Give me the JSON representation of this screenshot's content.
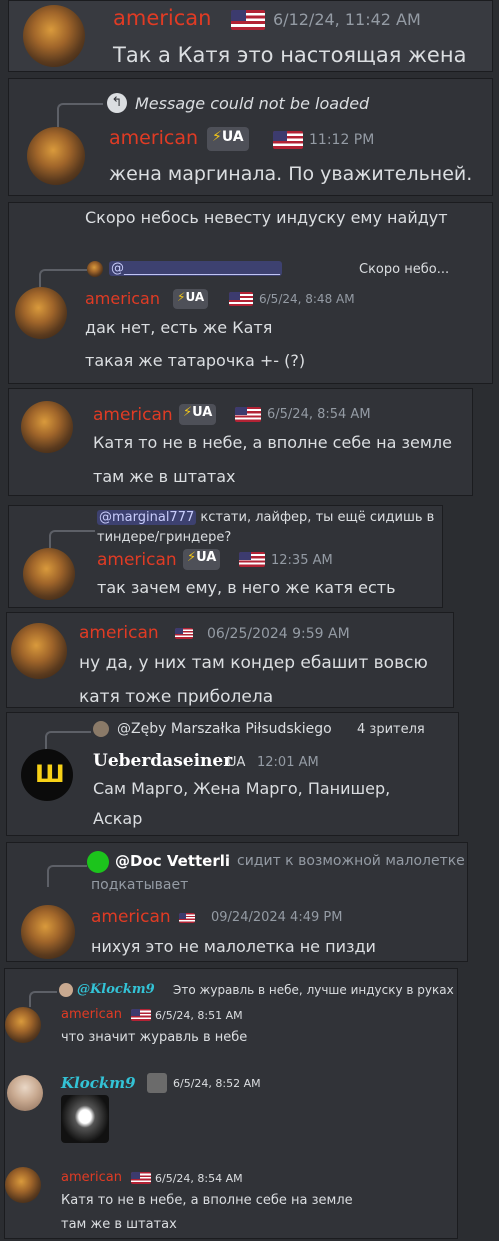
{
  "m1": {
    "author": "american",
    "time": "6/12/24, 11:42 AM",
    "text": "Так а Катя это настоящая жена"
  },
  "m2": {
    "reply_text": "Message could not be loaded",
    "author": "american",
    "badge": "UA",
    "time": "11:12 PM",
    "text": "жена маргинала. По уважительней."
  },
  "m3": {
    "prev_text": "Скоро небось невесту индуску ему найдут",
    "reply_mention": "@________________________",
    "reply_text": "Скоро небо...",
    "author": "american",
    "badge": "UA",
    "time": "6/5/24, 8:48 AM",
    "line1": "дак нет, есть же Катя",
    "line2": "такая же татарочка +- (?)"
  },
  "m4": {
    "author": "american",
    "badge": "UA",
    "time": "6/5/24, 8:54 AM",
    "line1": "Катя то не в небе, а вполне себе на земле",
    "line2": "там же в штатах"
  },
  "m5": {
    "reply_mention": "@marginal777",
    "reply_text1": "кстати, лайфер, ты ещё сидишь в",
    "reply_text2": "тиндере/гриндере?",
    "author": "american",
    "badge": "UA",
    "time": "12:35 AM",
    "text": "так зачем ему, в него же катя есть"
  },
  "m6": {
    "author": "american",
    "time": "06/25/2024 9:59 AM",
    "line1": "ну да, у них там кондер ебашит вовсю",
    "line2": "катя тоже приболела"
  },
  "m7": {
    "reply_name": "@Zęby Marszałka Piłsudskiego",
    "reply_text": "4 зрителя",
    "author": "Ueberdaseiner",
    "badge": "UA",
    "time": "12:01 AM",
    "line1": "Сам Марго, Жена Марго, Панишер,",
    "line2": "Аскар"
  },
  "m8": {
    "reply_name": "@Doc Vetterli",
    "reply_text1": "сидит к возможной малолетке",
    "reply_text2": "подкатывает",
    "author": "american",
    "time": "09/24/2024 4:49 PM",
    "text": "нихуя это не малолетка не пизди"
  },
  "m9": {
    "reply_name": "@Klockm9",
    "reply_text": "Это журавль в небе,  лучше индуску в руках",
    "a1": "american",
    "t1": "6/5/24, 8:51 AM",
    "x1": "что значит журавль в небе",
    "a2": "Klockm9",
    "t2": "6/5/24, 8:52 AM",
    "a3": "american",
    "t3": "6/5/24, 8:54 AM",
    "x3a": "Катя то не в небе, а вполне себе на земле",
    "x3b": "там же в штатах"
  },
  "colors": {
    "author": "#e03b24",
    "klockm": "#33c3d6",
    "bg": "#313338",
    "outer": "#2b2d31"
  }
}
